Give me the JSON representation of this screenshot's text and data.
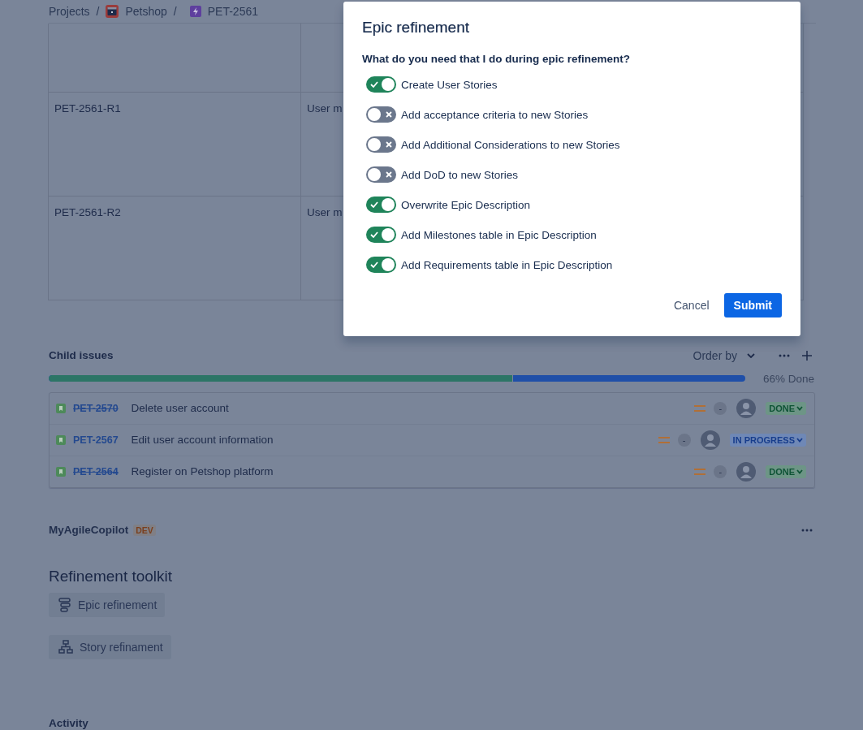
{
  "breadcrumbs": [
    {
      "kind": "link",
      "label": "Projects"
    },
    {
      "kind": "separator",
      "label": "/"
    },
    {
      "kind": "project",
      "label": "Petshop"
    },
    {
      "kind": "separator",
      "label": "/"
    },
    {
      "kind": "epic",
      "label": "PET-2561"
    }
  ],
  "requirements_table": {
    "rows": [
      {},
      {
        "column_1": "PET-2561-R1",
        "column_2": "User m"
      },
      {
        "column_1": "PET-2561-R2",
        "column_2": "User m"
      }
    ]
  },
  "child_issues": {
    "title": "Child issues",
    "order_by": "Order by",
    "progress": {
      "level": 0.666,
      "label": "66% Done"
    },
    "issues": [
      {
        "key": "PET-2570",
        "summary": "Delete user account",
        "resolved": true,
        "estimate": "-",
        "status": "DONE",
        "kind": "done"
      },
      {
        "key": "PET-2567",
        "summary": "Edit user account information",
        "resolved": false,
        "estimate": "-",
        "status": "IN PROGRESS",
        "kind": "in_progress"
      },
      {
        "key": "PET-2564",
        "summary": "Register on Petshop platform",
        "resolved": true,
        "estimate": "-",
        "status": "DONE",
        "kind": "done"
      }
    ]
  },
  "copilot": {
    "title": "MyAgileCopilot",
    "badge": "DEV",
    "heading": "Refinement toolkit",
    "actions": [
      {
        "kind": "epic",
        "label": "Epic refinement"
      },
      {
        "kind": "story",
        "label": "Story refinament"
      }
    ]
  },
  "activity": {
    "title": "Activity"
  },
  "modal": {
    "title": "Epic refinement",
    "question": "What do you need that I do during epic refinement?",
    "options": [
      {
        "label": "Create User Stories",
        "on": true
      },
      {
        "label": "Add acceptance criteria to new Stories",
        "on": false
      },
      {
        "label": "Add Additional Considerations to new Stories",
        "on": false
      },
      {
        "label": "Add DoD to new Stories",
        "on": false
      },
      {
        "label": "Overwrite Epic Description",
        "on": true
      },
      {
        "label": "Add Milestones table in Epic Description",
        "on": true
      },
      {
        "label": "Add Requirements table in Epic Description",
        "on": true
      }
    ],
    "buttons": [
      {
        "kind": "subtle",
        "label": "Cancel"
      },
      {
        "kind": "primary",
        "label": "Submit"
      }
    ]
  }
}
